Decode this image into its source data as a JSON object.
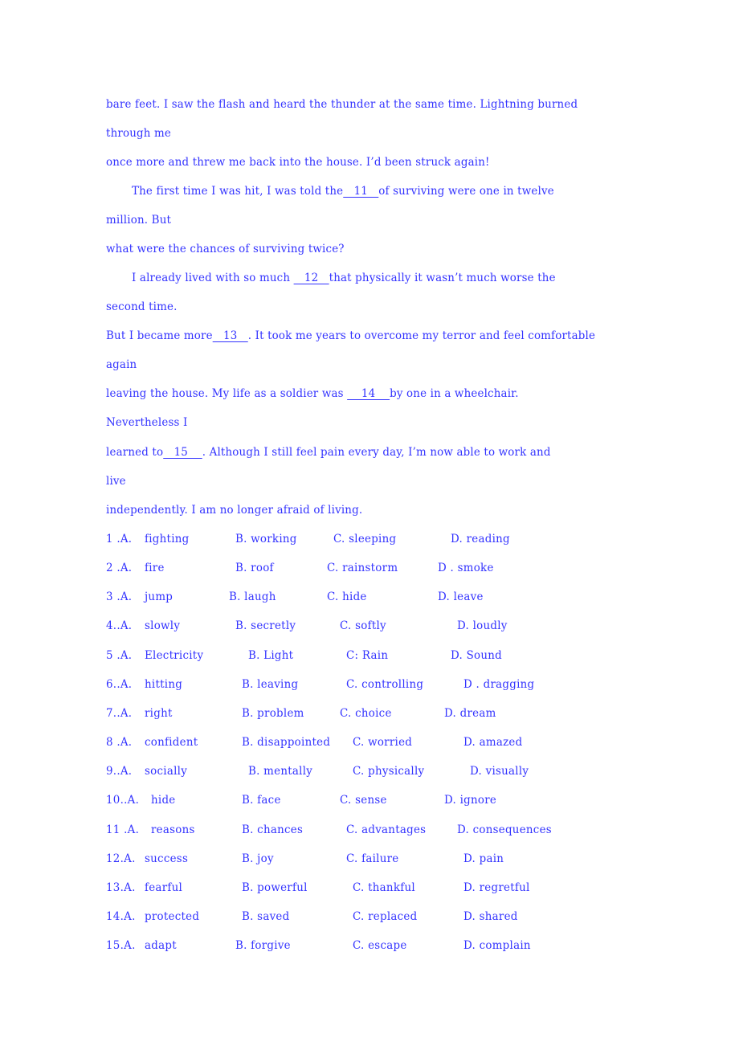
{
  "passage": {
    "lines": [
      {
        "text": "bare feet. I saw the flash and heard the thunder at the same time. Lightning burned"
      },
      {
        "text": "through me"
      },
      {
        "text": "once more and threw me back into the house. I’d been struck again!"
      },
      {
        "pre": "The first time I was hit, I was told the",
        "blank": "   11   ",
        "post": "of surviving were one in twelve"
      },
      {
        "text": "million. But"
      },
      {
        "text": "what were the chances of surviving twice?"
      },
      {
        "pre": "I already lived with so much ",
        "blank": "   12   ",
        "post": "that physically it wasn’t much worse the"
      },
      {
        "text": "second time."
      },
      {
        "pre": "But I became more",
        "blank": "   13   ",
        "post": ". It took me years to overcome my terror and feel comfortable"
      },
      {
        "text": "again"
      },
      {
        "pre": "leaving the house. My life as a soldier was ",
        "blank": "    14    ",
        "post": "by one in a wheelchair."
      },
      {
        "text": "Nevertheless I"
      },
      {
        "pre": "learned to",
        "blank": "   15    ",
        "post": ". Although I still feel pain every day, I’m now able to work and"
      },
      {
        "text": "live"
      },
      {
        "text": "independently. I am no longer afraid of living."
      }
    ]
  },
  "questions": [
    {
      "num": "1 .A.",
      "a": "fighting",
      "b": "B. working",
      "c": "C. sleeping",
      "d": "D. reading"
    },
    {
      "num": "2 .A.",
      "a": "fire",
      "b": "B. roof",
      "c": "C. rainstorm",
      "d": "D . smoke"
    },
    {
      "num": "3 .A.",
      "a": "jump",
      "b": "B. laugh",
      "c": "C. hide",
      "d": "D. leave"
    },
    {
      "num": "4..A.",
      "a": "slowly",
      "b": "B. secretly",
      "c": "C. softly",
      "d": "D. loudly"
    },
    {
      "num": "5 .A.",
      "a": "Electricity",
      "b": "B. Light",
      "c": "C: Rain",
      "d": "D. Sound"
    },
    {
      "num": "6..A.",
      "a": "hitting",
      "b": "B. leaving",
      "c": "C. controlling",
      "d": "D . dragging"
    },
    {
      "num": "7..A.",
      "a": "right",
      "b": "B. problem",
      "c": "C. choice",
      "d": "D. dream"
    },
    {
      "num": "8 .A.",
      "a": "confident",
      "b": "B. disappointed",
      "c": "C. worried",
      "d": "D. amazed"
    },
    {
      "num": "9..A.",
      "a": "socially",
      "b": "B. mentally",
      "c": "C. physically",
      "d": "D. visually"
    },
    {
      "num": "10..A.",
      "a": "hide",
      "b": "B. face",
      "c": "C. sense",
      "d": "D. ignore"
    },
    {
      "num": "11 .A.",
      "a": "reasons",
      "b": "B. chances",
      "c": "C. advantages",
      "d": "D. consequences"
    },
    {
      "num": "12.A.",
      "a": "success",
      "b": "B. joy",
      "c": "C. failure",
      "d": "D. pain"
    },
    {
      "num": "13.A.",
      "a": "fearful",
      "b": "B. powerful",
      "c": "C. thankful",
      "d": "D. regretful"
    },
    {
      "num": "14.A.",
      "a": "protected",
      "b": "B. saved",
      "c": "C. replaced",
      "d": "D. shared"
    },
    {
      "num": "15.A.",
      "a": "adapt",
      "b": "B. forgive",
      "c": "C. escape",
      "d": "D. complain"
    }
  ]
}
